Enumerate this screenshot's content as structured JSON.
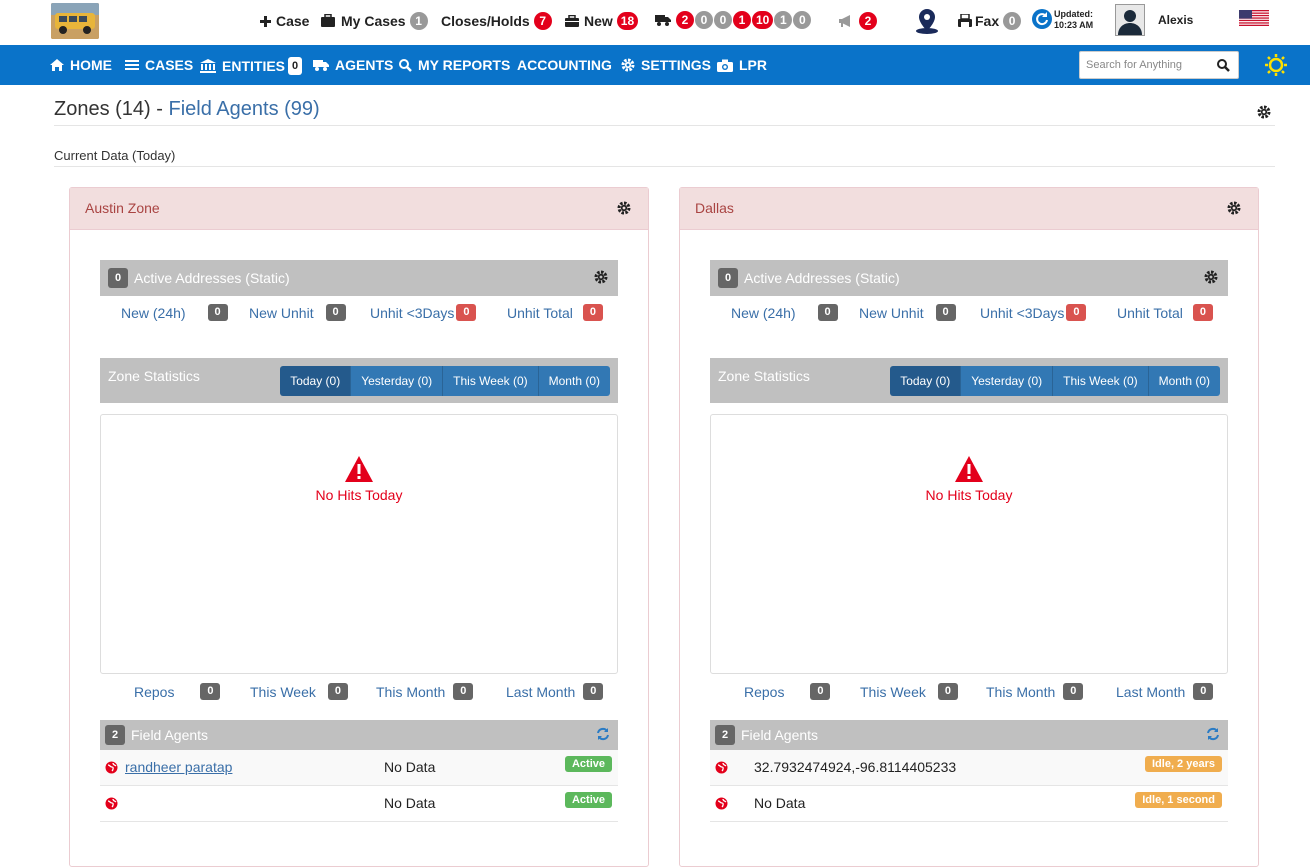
{
  "topbar": {
    "new_case": "Case",
    "my_cases": "My Cases",
    "my_cases_count": "1",
    "closes_holds": "Closes/Holds",
    "closes_holds_count": "7",
    "new_label": "New",
    "new_count": "18",
    "truck_counts": [
      "2",
      "0",
      "0",
      "1",
      "10",
      "1",
      "0"
    ],
    "announce_count": "2",
    "fax": "Fax",
    "fax_count": "0",
    "updated_label": "Updated:",
    "updated_time": "10:23 AM",
    "user_name": "Alexis"
  },
  "nav": {
    "home": "HOME",
    "cases": "CASES",
    "entities": "ENTITIES",
    "entities_count": "0",
    "agents": "AGENTS",
    "my_reports": "MY REPORTS",
    "accounting": "ACCOUNTING",
    "settings": "SETTINGS",
    "lpr": "LPR",
    "search_placeholder": "Search for Anything"
  },
  "page": {
    "zones_title": "Zones (14) -",
    "field_agents_link": "Field Agents (99)",
    "current_data": "Current Data (Today)"
  },
  "colors": {
    "nav_blue": "#0a73c9",
    "zone_header_bg": "#f2dede",
    "zone_header_text": "#a94442",
    "link_blue": "#3a6fa8",
    "alert_red": "#e3001b",
    "status_active": "#5cb85c",
    "status_idle": "#f0ad4e"
  },
  "zones": [
    {
      "name": "Austin Zone",
      "active_addresses_count": "0",
      "active_addresses_label": "Active Addresses (Static)",
      "stats": [
        {
          "label": "New (24h)",
          "count": "0",
          "red": false
        },
        {
          "label": "New Unhit",
          "count": "0",
          "red": false
        },
        {
          "label": "Unhit <3Days",
          "count": "0",
          "red": true
        },
        {
          "label": "Unhit Total",
          "count": "0",
          "red": true
        }
      ],
      "zone_statistics_label": "Zone Statistics",
      "tabs": [
        "Today (0)",
        "Yesterday (0)",
        "This Week (0)",
        "Month (0)"
      ],
      "no_hits": "No Hits Today",
      "repos": [
        {
          "label": "Repos",
          "count": "0"
        },
        {
          "label": "This Week",
          "count": "0"
        },
        {
          "label": "This Month",
          "count": "0"
        },
        {
          "label": "Last Month",
          "count": "0"
        }
      ],
      "field_agents_count": "2",
      "field_agents_label": "Field Agents",
      "agents": [
        {
          "name": "randheer paratap",
          "data": "No Data",
          "status": "Active"
        },
        {
          "name": "",
          "data": "No Data",
          "status": "Active"
        }
      ]
    },
    {
      "name": "Dallas",
      "active_addresses_count": "0",
      "active_addresses_label": "Active Addresses (Static)",
      "stats": [
        {
          "label": "New (24h)",
          "count": "0",
          "red": false
        },
        {
          "label": "New Unhit",
          "count": "0",
          "red": false
        },
        {
          "label": "Unhit <3Days",
          "count": "0",
          "red": true
        },
        {
          "label": "Unhit Total",
          "count": "0",
          "red": true
        }
      ],
      "zone_statistics_label": "Zone Statistics",
      "tabs": [
        "Today (0)",
        "Yesterday (0)",
        "This Week (0)",
        "Month (0)"
      ],
      "no_hits": "No Hits Today",
      "repos": [
        {
          "label": "Repos",
          "count": "0"
        },
        {
          "label": "This Week",
          "count": "0"
        },
        {
          "label": "This Month",
          "count": "0"
        },
        {
          "label": "Last Month",
          "count": "0"
        }
      ],
      "field_agents_count": "2",
      "field_agents_label": "Field Agents",
      "agents": [
        {
          "name": "",
          "data": "32.7932474924,-96.8114405233",
          "status": "Idle, 2 years"
        },
        {
          "name": "",
          "data": "No Data",
          "status": "Idle, 1 second"
        }
      ]
    }
  ]
}
